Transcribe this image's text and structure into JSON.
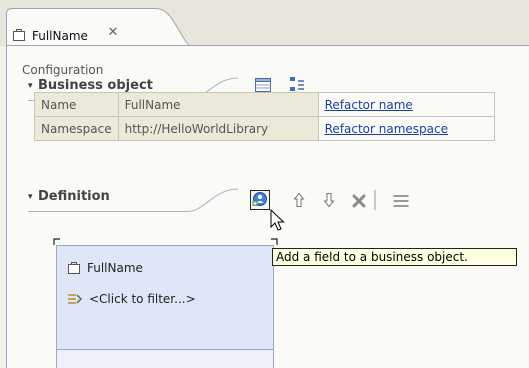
{
  "editor_tab": {
    "title": "FullName",
    "close_glyph": "✕"
  },
  "business_object_section": {
    "title": "Business object",
    "twisty": "▾",
    "toolbar": {
      "table_view_icon": "table-icon",
      "tree_view_icon": "tree-icon"
    }
  },
  "configuration": {
    "label": "Configuration",
    "rows": [
      {
        "key": "Name",
        "value": "FullName",
        "action": "Refactor name"
      },
      {
        "key": "Namespace",
        "value": "http://HelloWorldLibrary",
        "action": "Refactor namespace"
      }
    ]
  },
  "definition_section": {
    "title": "Definition",
    "twisty": "▾",
    "toolbar": [
      "add-field-icon",
      "move-up-icon",
      "move-down-icon",
      "delete-icon",
      "show-details-icon"
    ]
  },
  "business_object_box": {
    "name": "FullName",
    "filter_placeholder": "<Click to filter...>"
  },
  "tooltip": {
    "text": "Add a field to a business object."
  },
  "colors": {
    "link": "#1b3fa8",
    "box_fill": "#dfe6f7",
    "tooltip_fill": "#ffffe1"
  }
}
